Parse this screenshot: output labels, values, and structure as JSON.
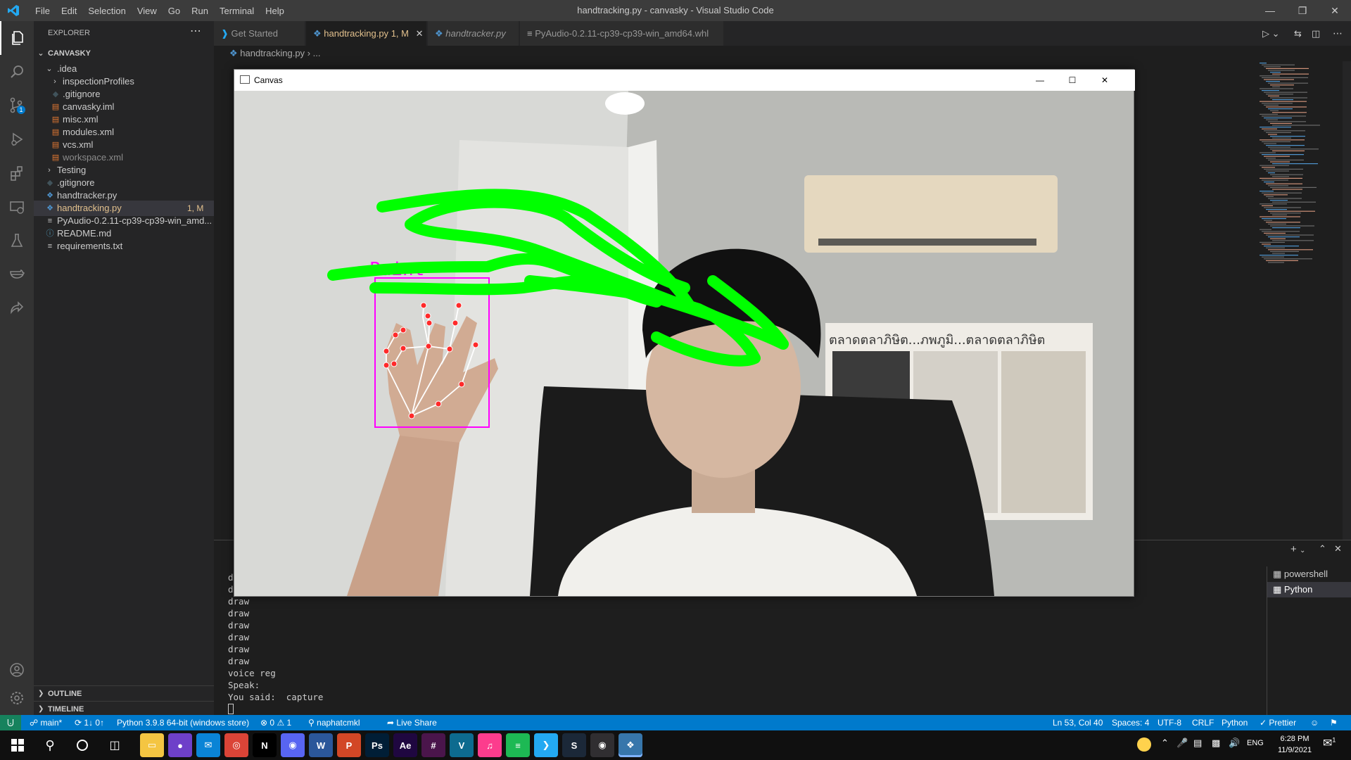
{
  "app": {
    "window_title": "handtracking.py - canvasky - Visual Studio Code",
    "menu": [
      "File",
      "Edit",
      "Selection",
      "View",
      "Go",
      "Run",
      "Terminal",
      "Help"
    ]
  },
  "explorer": {
    "header": "EXPLORER",
    "project": "CANVASKY",
    "items": [
      {
        "label": ".idea",
        "kind": "folder-open",
        "depth": 1
      },
      {
        "label": "inspectionProfiles",
        "kind": "folder",
        "depth": 2
      },
      {
        "label": ".gitignore",
        "kind": "gitignore",
        "depth": 2
      },
      {
        "label": "canvasky.iml",
        "kind": "xml",
        "depth": 2
      },
      {
        "label": "misc.xml",
        "kind": "xml",
        "depth": 2
      },
      {
        "label": "modules.xml",
        "kind": "xml",
        "depth": 2
      },
      {
        "label": "vcs.xml",
        "kind": "xml",
        "depth": 2
      },
      {
        "label": "workspace.xml",
        "kind": "xml",
        "depth": 2
      },
      {
        "label": "Testing",
        "kind": "folder",
        "depth": 1
      },
      {
        "label": ".gitignore",
        "kind": "gitignore",
        "depth": 1
      },
      {
        "label": "handtracker.py",
        "kind": "python",
        "depth": 1
      },
      {
        "label": "handtracking.py",
        "kind": "python",
        "depth": 1,
        "badge": "1, M",
        "selected": true
      },
      {
        "label": "PyAudio-0.2.11-cp39-cp39-win_amd...",
        "kind": "file",
        "depth": 1
      },
      {
        "label": "README.md",
        "kind": "info",
        "depth": 1
      },
      {
        "label": "requirements.txt",
        "kind": "file",
        "depth": 1
      }
    ],
    "outline": "OUTLINE",
    "timeline": "TIMELINE"
  },
  "tabs": [
    {
      "label": "Get Started",
      "icon": "vscode-icon"
    },
    {
      "label": "handtracking.py",
      "badge": "1, M",
      "icon": "python-icon",
      "active": true
    },
    {
      "label": "handtracker.py",
      "icon": "python-icon",
      "italic": true
    },
    {
      "label": "PyAudio-0.2.11-cp39-cp39-win_amd64.whl",
      "icon": "file-icon"
    }
  ],
  "breadcrumb": {
    "file": "handtracking.py",
    "rest": "..."
  },
  "terminal": {
    "lines": [
      "draw",
      "draw",
      "draw",
      "draw",
      "draw",
      "draw",
      "draw",
      "draw",
      "voice reg",
      "Speak:",
      "You said:  capture"
    ],
    "shells": [
      "powershell",
      "Python"
    ]
  },
  "canvas_window": {
    "title": "Canvas",
    "overlay_text": "Paint"
  },
  "statusbar": {
    "branch": "main*",
    "sync": "1↓ 0↑",
    "interpreter": "Python 3.9.8 64-bit (windows store)",
    "problems_errors": "0",
    "problems_warnings": "1",
    "user": "naphatcmkl",
    "live_share": "Live Share",
    "cursor": "Ln 53, Col 40",
    "spaces": "Spaces: 4",
    "encoding": "UTF-8",
    "eol": "CRLF",
    "language": "Python",
    "formatter": "Prettier"
  },
  "taskbar": {
    "lang": "ENG",
    "time": "6:28 PM",
    "date": "11/9/2021",
    "notif_count": "1",
    "apps": [
      "explorer",
      "github-desktop",
      "mail",
      "chrome",
      "netflix",
      "discord",
      "word",
      "powerpoint",
      "photoshop",
      "after-effects",
      "slack",
      "vegas",
      "itunes",
      "spotify",
      "vscode",
      "steam",
      "obs",
      "python"
    ]
  },
  "colors": {
    "accent": "#007acc",
    "draw_green": "#00ff00",
    "bbox_magenta": "#ff00ff"
  }
}
